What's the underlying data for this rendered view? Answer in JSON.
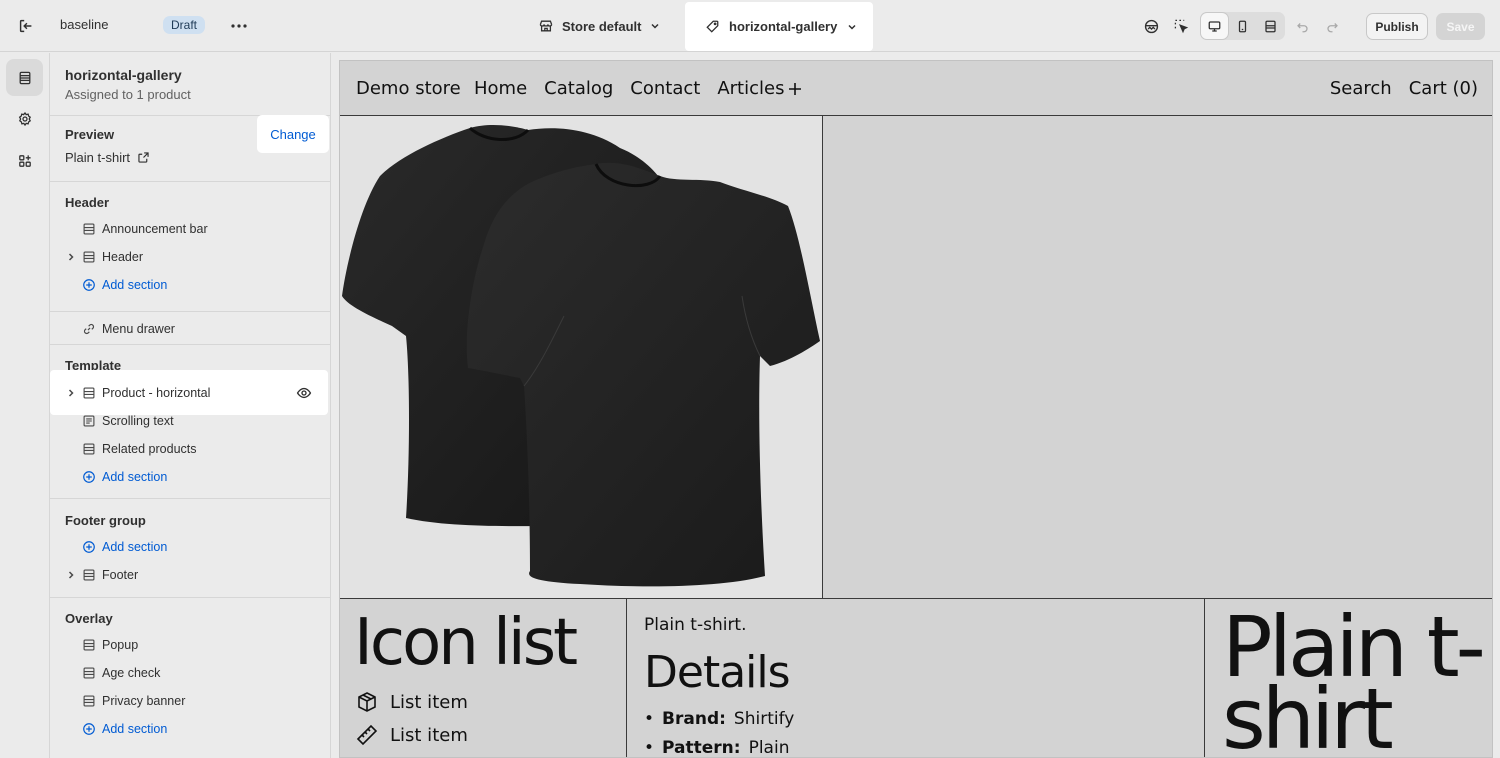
{
  "topbar": {
    "theme_name": "baseline",
    "status_badge": "Draft",
    "store_selector": "Store default",
    "template_selector": "horizontal-gallery",
    "publish_label": "Publish",
    "save_label": "Save"
  },
  "sidebar": {
    "template_title": "horizontal-gallery",
    "template_subtitle": "Assigned to 1 product",
    "preview_heading": "Preview",
    "preview_product": "Plain t-shirt",
    "change_label": "Change",
    "header_heading": "Header",
    "header_items": [
      "Announcement bar",
      "Header"
    ],
    "add_section_label": "Add section",
    "menu_drawer": "Menu drawer",
    "template_heading": "Template",
    "template_items": [
      "Product - horizontal",
      "Scrolling text",
      "Related products"
    ],
    "footer_heading": "Footer group",
    "footer_items": [
      "Footer"
    ],
    "overlay_heading": "Overlay",
    "overlay_items": [
      "Popup",
      "Age check",
      "Privacy banner"
    ]
  },
  "storefront": {
    "logo": "Demo store",
    "nav": [
      "Home",
      "Catalog",
      "Contact",
      "Articles"
    ],
    "search": "Search",
    "cart": "Cart (0)",
    "icon_list_title": "Icon list",
    "list_items": [
      "List item",
      "List item"
    ],
    "product_small": "Plain t-shirt.",
    "details_title": "Details",
    "details": [
      {
        "label": "Brand:",
        "value": "Shirtify"
      },
      {
        "label": "Pattern:",
        "value": "Plain"
      }
    ],
    "big_title": "Plain t-shirt"
  },
  "colors": {
    "accent": "#005bd3",
    "badge_bg": "#cfe0f1",
    "shirt": "#1f1f1f"
  },
  "icons": {
    "exit": "exit-icon",
    "more": "more-horizontal-icon",
    "store": "store-icon",
    "tag": "tag-icon",
    "sections": "sections-icon",
    "settings": "gear-icon",
    "apps": "apps-icon"
  }
}
